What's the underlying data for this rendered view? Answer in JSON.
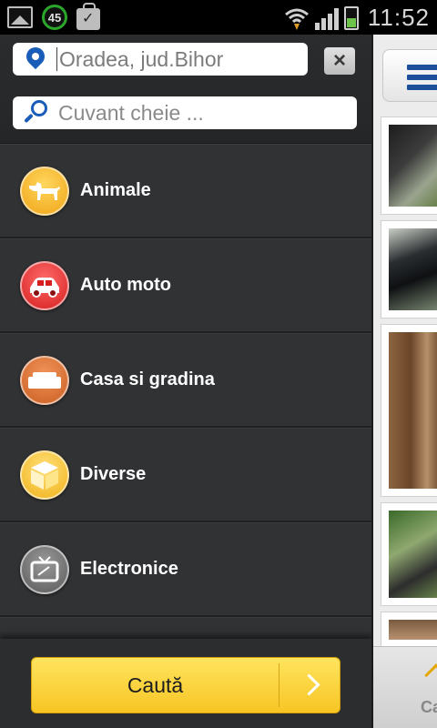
{
  "status_bar": {
    "badge_count": "45",
    "time": "11:52",
    "icons": [
      "gallery-icon",
      "notification-badge-icon",
      "shopping-bag-icon",
      "wifi-icon",
      "signal-icon",
      "battery-icon"
    ]
  },
  "drawer": {
    "location": {
      "value": "Oradea, jud.Bihor",
      "icon": "location-pin-icon",
      "clear_icon": "×"
    },
    "keyword": {
      "placeholder": "Cuvant cheie ...",
      "icon": "search-icon"
    },
    "categories": [
      {
        "label": "Animale",
        "icon": "dog-icon",
        "color": "#f0a417"
      },
      {
        "label": "Auto moto",
        "icon": "car-icon",
        "color": "#d51f1f"
      },
      {
        "label": "Casa si gradina",
        "icon": "sofa-icon",
        "color": "#cb5f22"
      },
      {
        "label": "Diverse",
        "icon": "box-icon",
        "color": "#f0b21a"
      },
      {
        "label": "Electronice",
        "icon": "tv-icon",
        "color": "#5a5a5a"
      }
    ],
    "search_button": {
      "label": "Caută",
      "icon": "chevron-right-icon"
    }
  },
  "content_peek": {
    "menu_icon": "hamburger-menu-icon",
    "footer_label": "Ca",
    "accent": "#1d4f9a"
  }
}
